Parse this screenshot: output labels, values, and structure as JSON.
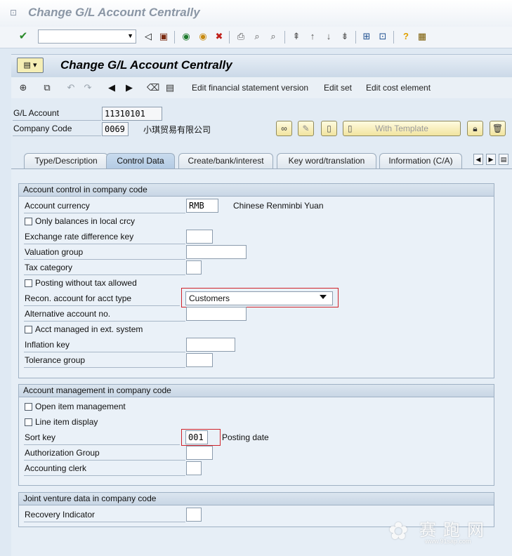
{
  "window": {
    "title": "Change G/L Account Centrally"
  },
  "header": {
    "title": "Change G/L Account Centrally"
  },
  "app_toolbar": {
    "links": [
      "Edit financial statement version",
      "Edit set",
      "Edit cost element"
    ]
  },
  "account": {
    "gl_account_label": "G/L Account",
    "gl_account_value": "11310101",
    "company_code_label": "Company Code",
    "company_code_value": "0069",
    "company_name": "小琪贸易有限公司"
  },
  "buttons": {
    "with_template": "With Template"
  },
  "tabs": [
    {
      "label": "Type/Description",
      "active": false
    },
    {
      "label": "Control Data",
      "active": true
    },
    {
      "label": "Create/bank/interest",
      "active": false
    },
    {
      "label": "Key word/translation",
      "active": false
    },
    {
      "label": "Information (C/A)",
      "active": false
    }
  ],
  "account_control": {
    "title": "Account control in company code",
    "account_currency_label": "Account currency",
    "account_currency_value": "RMB",
    "account_currency_text": "Chinese Renminbi Yuan",
    "only_balances_label": "Only balances in local crcy",
    "exchange_rate_label": "Exchange rate difference key",
    "valuation_group_label": "Valuation group",
    "tax_category_label": "Tax category",
    "posting_without_tax_label": "Posting without tax allowed",
    "recon_account_label": "Recon. account for acct type",
    "recon_account_value": "Customers",
    "alt_account_label": "Alternative account no.",
    "acct_managed_label": "Acct managed in ext. system",
    "inflation_key_label": "Inflation key",
    "tolerance_group_label": "Tolerance group"
  },
  "account_mgmt": {
    "title": "Account management in company code",
    "open_item_label": "Open item management",
    "line_item_label": "Line item display",
    "sort_key_label": "Sort key",
    "sort_key_value": "001",
    "sort_key_text": "Posting date",
    "auth_group_label": "Authorization Group",
    "acct_clerk_label": "Accounting clerk"
  },
  "joint_venture": {
    "title": "Joint venture data in company code",
    "recovery_label": "Recovery Indicator"
  },
  "watermark": {
    "main": "赛跑网",
    "sub": "www.91sap.com"
  }
}
